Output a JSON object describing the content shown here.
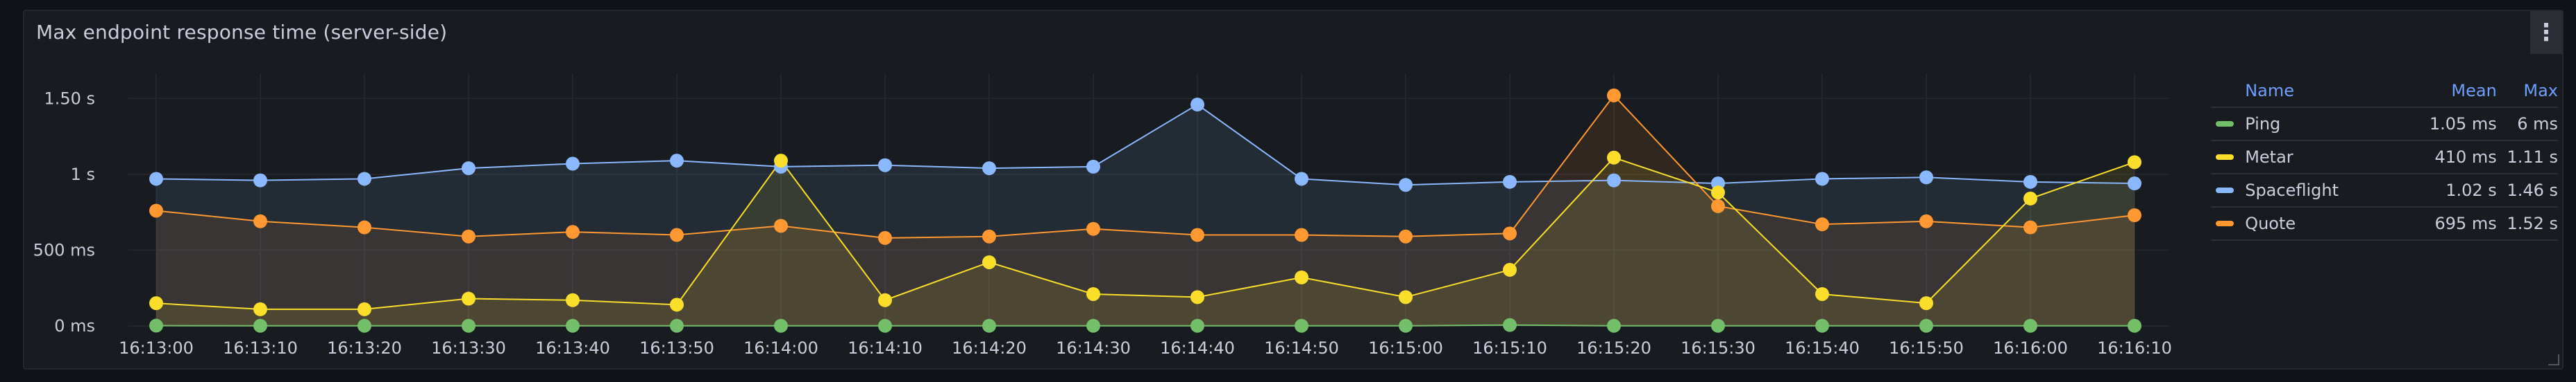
{
  "panel": {
    "title": "Max endpoint response time (server-side)",
    "menu_icon": "kebab-vertical-icon"
  },
  "legend": {
    "headers": {
      "name": "Name",
      "mean": "Mean",
      "max": "Max"
    },
    "items": [
      {
        "name": "Ping",
        "mean": "1.05 ms",
        "max": "6 ms",
        "color": "#73bf69"
      },
      {
        "name": "Metar",
        "mean": "410 ms",
        "max": "1.11 s",
        "color": "#fade2a"
      },
      {
        "name": "Spaceflight",
        "mean": "1.02 s",
        "max": "1.46 s",
        "color": "#8ab8ff"
      },
      {
        "name": "Quote",
        "mean": "695 ms",
        "max": "1.52 s",
        "color": "#ff9830"
      }
    ]
  },
  "chart_data": {
    "type": "line",
    "x": [
      "16:13:00",
      "16:13:10",
      "16:13:20",
      "16:13:30",
      "16:13:40",
      "16:13:50",
      "16:14:00",
      "16:14:10",
      "16:14:20",
      "16:14:30",
      "16:14:40",
      "16:14:50",
      "16:15:00",
      "16:15:10",
      "16:15:20",
      "16:15:30",
      "16:15:40",
      "16:15:50",
      "16:16:00",
      "16:16:10"
    ],
    "y_ticks": [
      {
        "value": 0,
        "label": "0 ms"
      },
      {
        "value": 500,
        "label": "500 ms"
      },
      {
        "value": 1000,
        "label": "1 s"
      },
      {
        "value": 1500,
        "label": "1.50 s"
      }
    ],
    "ylim": [
      0,
      1620
    ],
    "y_unit": "ms",
    "grid": true,
    "legend_position": "right",
    "series": [
      {
        "name": "Spaceflight",
        "color": "#8ab8ff",
        "values": [
          970,
          960,
          970,
          1040,
          1070,
          1090,
          1050,
          1060,
          1040,
          1050,
          1460,
          970,
          930,
          950,
          960,
          940,
          970,
          980,
          950,
          940
        ]
      },
      {
        "name": "Quote",
        "color": "#ff9830",
        "values": [
          760,
          690,
          650,
          590,
          620,
          600,
          660,
          580,
          590,
          640,
          600,
          600,
          590,
          610,
          1520,
          790,
          670,
          690,
          650,
          730
        ]
      },
      {
        "name": "Metar",
        "color": "#fade2a",
        "values": [
          150,
          110,
          110,
          180,
          170,
          140,
          1090,
          170,
          420,
          210,
          190,
          320,
          190,
          370,
          1110,
          880,
          210,
          150,
          840,
          1080
        ]
      },
      {
        "name": "Ping",
        "color": "#73bf69",
        "values": [
          2,
          1,
          1,
          1,
          1,
          1,
          1,
          1,
          1,
          1,
          1,
          1,
          1,
          6,
          1,
          1,
          1,
          1,
          1,
          1
        ]
      }
    ]
  }
}
